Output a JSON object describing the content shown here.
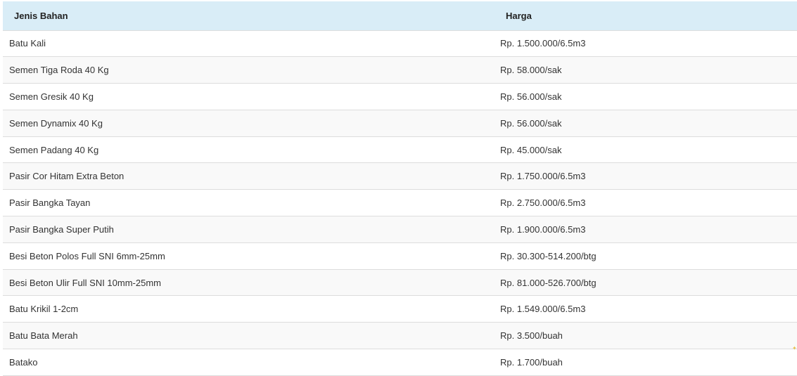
{
  "table": {
    "headers": {
      "name": "Jenis Bahan",
      "price": "Harga"
    },
    "rows": [
      {
        "name": "Batu Kali",
        "price": "Rp. 1.500.000/6.5m3"
      },
      {
        "name": "Semen Tiga Roda 40 Kg",
        "price": "Rp. 58.000/sak"
      },
      {
        "name": "Semen Gresik 40 Kg",
        "price": "Rp. 56.000/sak"
      },
      {
        "name": "Semen Dynamix 40 Kg",
        "price": "Rp. 56.000/sak"
      },
      {
        "name": "Semen Padang 40 Kg",
        "price": "Rp. 45.000/sak"
      },
      {
        "name": "Pasir Cor Hitam Extra Beton",
        "price": "Rp. 1.750.000/6.5m3"
      },
      {
        "name": "Pasir Bangka Tayan",
        "price": "Rp. 2.750.000/6.5m3"
      },
      {
        "name": "Pasir Bangka Super Putih",
        "price": "Rp. 1.900.000/6.5m3"
      },
      {
        "name": "Besi Beton Polos Full SNI 6mm-25mm",
        "price": "Rp. 30.300-514.200/btg"
      },
      {
        "name": "Besi Beton Ulir Full SNI 10mm-25mm",
        "price": "Rp. 81.000-526.700/btg"
      },
      {
        "name": "Batu Krikil 1-2cm",
        "price": "Rp. 1.549.000/6.5m3"
      },
      {
        "name": "Batu Bata Merah",
        "price": "Rp. 3.500/buah"
      },
      {
        "name": "Batako",
        "price": "Rp. 1.700/buah"
      }
    ]
  },
  "colors": {
    "header_bg": "#d9edf7",
    "row_alt_bg": "#f9f9f9",
    "border": "#dddddd",
    "text": "#333333"
  }
}
